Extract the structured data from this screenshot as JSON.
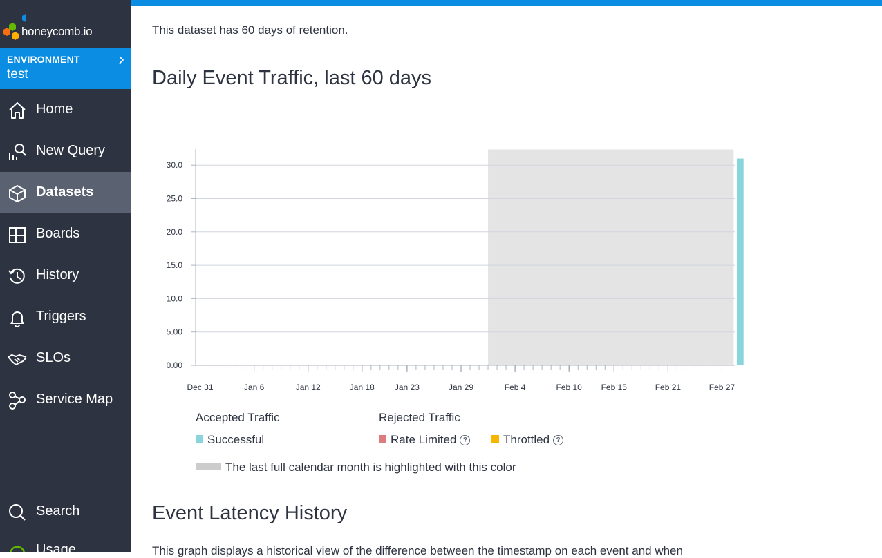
{
  "colors": {
    "sidebar_bg": "#2d3340",
    "accent": "#0b8de4",
    "active_nav": "#5a6271",
    "successful": "#88d6dc",
    "rate_limited": "#dc7c7c",
    "throttled": "#f7b500",
    "highlight": "#e4e4e4"
  },
  "brand": {
    "name": "honeycomb.io",
    "logo_icon": "hexagon-cluster-logo"
  },
  "environment": {
    "label": "ENVIRONMENT",
    "name": "test"
  },
  "nav": [
    {
      "label": "Home",
      "icon": "home-icon"
    },
    {
      "label": "New Query",
      "icon": "query-icon"
    },
    {
      "label": "Datasets",
      "icon": "cube-icon",
      "active": true
    },
    {
      "label": "Boards",
      "icon": "boards-icon"
    },
    {
      "label": "History",
      "icon": "history-icon"
    },
    {
      "label": "Triggers",
      "icon": "bell-icon"
    },
    {
      "label": "SLOs",
      "icon": "handshake-icon"
    },
    {
      "label": "Service Map",
      "icon": "service-map-icon"
    }
  ],
  "bottom_nav": [
    {
      "label": "Search",
      "icon": "search-icon"
    },
    {
      "label": "Usage",
      "icon": "usage-icon"
    }
  ],
  "main": {
    "retention_text": "This dataset has 60 days of retention.",
    "traffic_title": "Daily Event Traffic, last 60 days",
    "latency_title": "Event Latency History",
    "latency_desc": "This graph displays a historical view of the difference between the timestamp on each event and when"
  },
  "legend": {
    "accepted_title": "Accepted Traffic",
    "rejected_title": "Rejected Traffic",
    "successful": "Successful",
    "rate_limited": "Rate Limited",
    "throttled": "Throttled",
    "help_glyph": "?",
    "highlight_note": "The last full calendar month is highlighted with this color"
  },
  "chart_data": {
    "type": "bar",
    "x_start": "Dec 31",
    "x_end": "Feb 29",
    "x_tick_labels": [
      "Dec 31",
      "Jan 6",
      "Jan 12",
      "Jan 18",
      "Jan 23",
      "Jan 29",
      "Feb 4",
      "Feb 10",
      "Feb 15",
      "Feb 21",
      "Feb 27"
    ],
    "y_tick_labels": [
      "0.00",
      "5.00",
      "10.0",
      "15.0",
      "20.0",
      "25.0",
      "30.0"
    ],
    "ylim": [
      0,
      32.3
    ],
    "highlight_range": [
      "Feb 1",
      "Feb 29"
    ],
    "grid": true,
    "series": [
      {
        "name": "Successful",
        "points": [
          {
            "x": "Feb 29",
            "y": 31
          }
        ]
      },
      {
        "name": "Rate Limited",
        "points": []
      },
      {
        "name": "Throttled",
        "points": []
      }
    ]
  }
}
